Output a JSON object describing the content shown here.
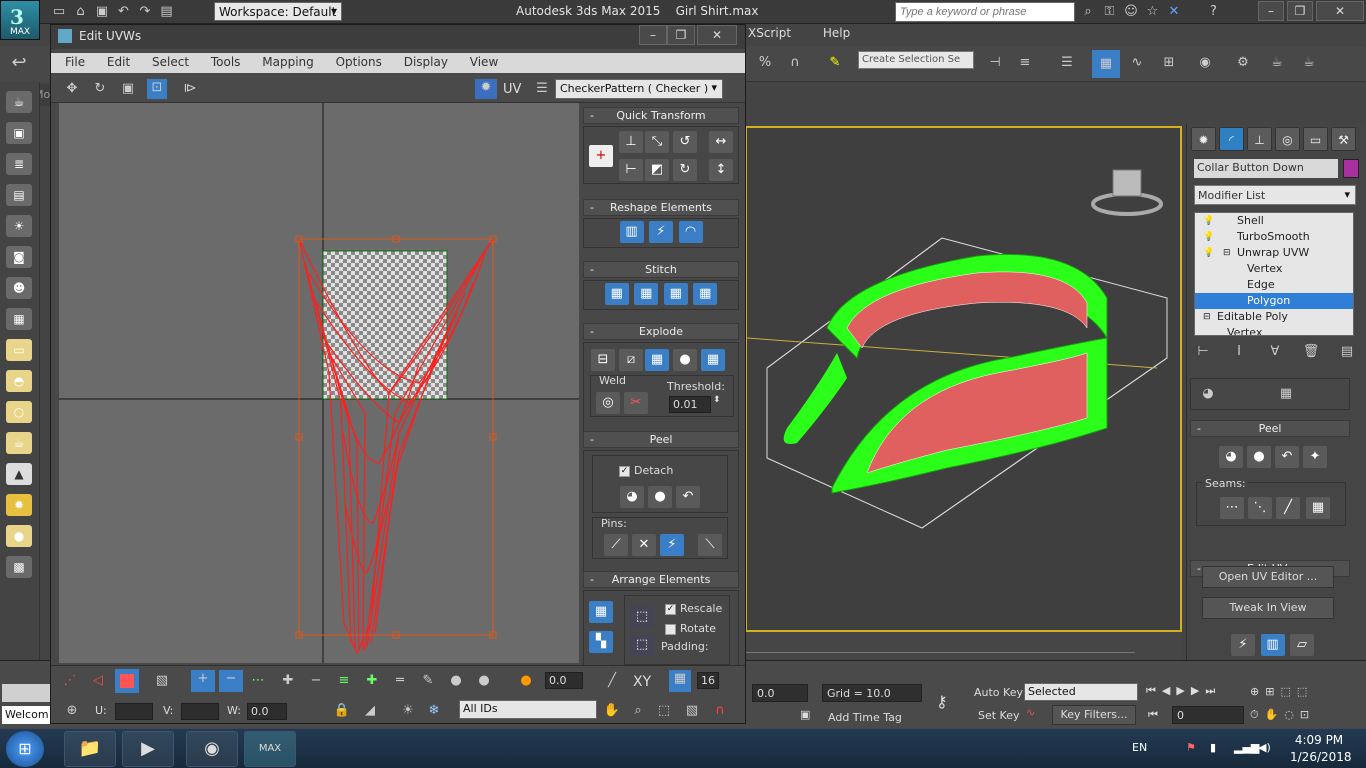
{
  "app": {
    "logo_label": "MAX",
    "workspace": "Workspace: Default",
    "title": "Autodesk 3ds Max  2015",
    "file": "Girl Shirt.max",
    "search_placeholder": "Type a keyword or phrase",
    "menu_partial": [
      "XScript",
      "Help"
    ],
    "selection_set_placeholder": "Create Selection Se",
    "toolbar_left_label": "Mo",
    "status_left": "Welcom"
  },
  "uv_editor": {
    "title": "Edit UVWs",
    "menu": [
      "File",
      "Edit",
      "Select",
      "Tools",
      "Mapping",
      "Options",
      "Display",
      "View"
    ],
    "uv_label": "UV",
    "checker_pattern": "CheckerPattern  ( Checker )",
    "panels": {
      "quick_transform": "Quick Transform",
      "reshape": "Reshape Elements",
      "stitch": "Stitch",
      "explode": "Explode",
      "weld": "Weld",
      "threshold_label": "Threshold:",
      "threshold_value": "0.01",
      "peel": "Peel",
      "detach": "Detach",
      "pins": "Pins:",
      "arrange": "Arrange Elements",
      "rescale": "Rescale",
      "rotate": "Rotate",
      "padding": "Padding:"
    },
    "bottom": {
      "soft_value": "0.0",
      "xy_label": "XY",
      "spin_value": "16",
      "u_label": "U:",
      "v_label": "V:",
      "w_label": "W:",
      "w_value": "0.0",
      "ids": "All IDs"
    }
  },
  "right_panel": {
    "object_name": "Collar Button Down",
    "modifier_list": "Modifier List",
    "stack": [
      "Shell",
      "TurboSmooth",
      "Unwrap UVW",
      "Vertex",
      "Edge",
      "Polygon",
      "Editable Poly",
      "Vertex"
    ],
    "peel_title": "Peel",
    "seams_label": "Seams:",
    "edit_uvs_title": "Edit UVs",
    "open_uv_editor": "Open UV Editor ...",
    "tweak_in_view": "Tweak In View"
  },
  "status": {
    "coord_value": "0.0",
    "grid": "Grid = 10.0",
    "add_time_tag": "Add Time Tag",
    "auto_key": "Auto Key",
    "set_key": "Set Key",
    "selected": "Selected",
    "key_filters": "Key Filters...",
    "frame": "0"
  },
  "taskbar": {
    "lang": "EN",
    "time": "4:09 PM",
    "date": "1/26/2018",
    "max_app_label": "MAX"
  },
  "colors": {
    "accent_blue": "#2f7fd8",
    "uv_red": "#ff1f1f",
    "mesh_green": "#2bff19",
    "object_color": "#a82fa0",
    "viewport_border": "#d4b020"
  }
}
